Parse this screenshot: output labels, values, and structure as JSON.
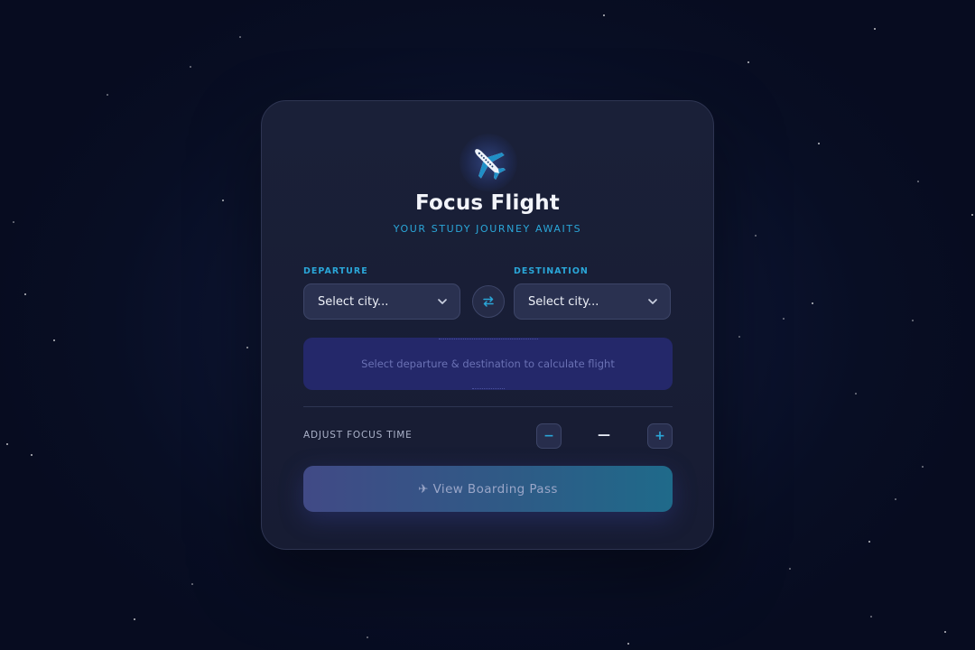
{
  "app": {
    "title": "Focus Flight",
    "subtitle": "YOUR STUDY JOURNEY AWAITS",
    "logo_icon": "airplane-icon"
  },
  "route": {
    "departure": {
      "label": "DEPARTURE",
      "value": "Select city..."
    },
    "destination": {
      "label": "DESTINATION",
      "value": "Select city..."
    },
    "swap_icon": "swap-arrows-icon"
  },
  "info": {
    "message": "Select departure & destination to calculate flight"
  },
  "focus_time": {
    "label": "ADJUST FOCUS TIME",
    "value": "—",
    "decrement_label": "−",
    "increment_label": "+"
  },
  "actions": {
    "boarding_pass_label": "✈ View Boarding Pass"
  },
  "colors": {
    "accent": "#2aa6d8",
    "background": "#0a1128",
    "card": "#1a2038",
    "info_box": "#24286a"
  }
}
